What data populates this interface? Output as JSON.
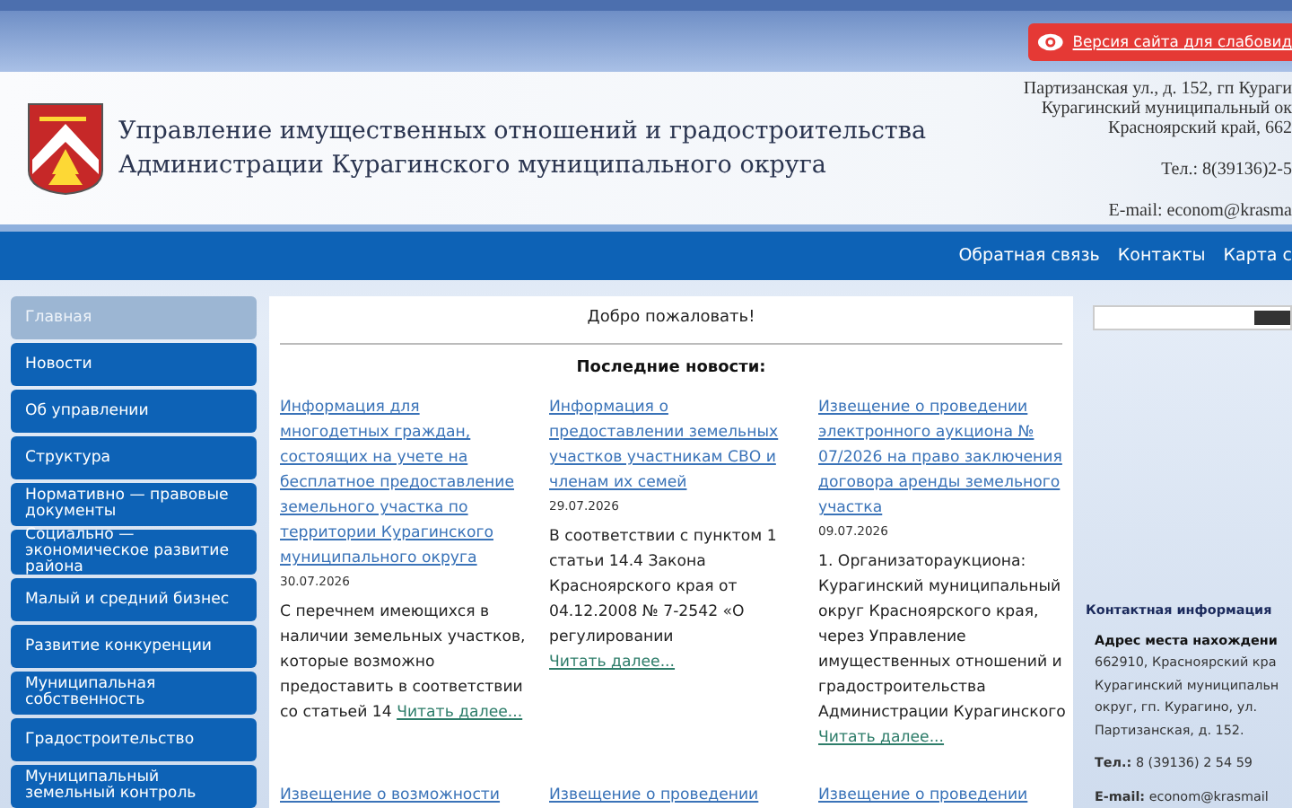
{
  "accessibility_button": {
    "label": "Версия сайта для слабовид"
  },
  "header": {
    "title_lines": [
      "Управление имущественных отношений и градостроительства",
      "Администрации Курагинского муниципального округа"
    ],
    "address_lines": [
      "Партизанская ул., д. 152, гп Кураги",
      "Курагинский муниципальный ок",
      "Красноярский край, 662"
    ],
    "phone": "Тел.: 8(39136)2-5",
    "email": "E-mail: econom@krasma"
  },
  "nav_links": [
    "Обратная связь",
    "Контакты",
    "Карта с"
  ],
  "sidebar": {
    "items": [
      {
        "label": "Главная",
        "selected": true
      },
      {
        "label": "Новости",
        "selected": false
      },
      {
        "label": "Об управлении",
        "selected": false
      },
      {
        "label": "Структура",
        "selected": false
      },
      {
        "label": "Нормативно — правовые документы",
        "selected": false
      },
      {
        "label": "Социально — экономическое развитие района",
        "selected": false
      },
      {
        "label": "Малый и средний бизнес",
        "selected": false
      },
      {
        "label": "Развитие конкуренции",
        "selected": false
      },
      {
        "label": "Муниципальная собственность",
        "selected": false
      },
      {
        "label": "Градостроительство",
        "selected": false
      },
      {
        "label": "Муниципальный земельный контроль",
        "selected": false
      }
    ]
  },
  "welcome": "Добро пожаловать!",
  "news_heading": "Последние новости:",
  "news": [
    {
      "title": "Информация для многодетных граждан, состоящих на учете на бесплатное предоставление земельного участка по территории Курагинского муниципального округа",
      "date": "30.07.2026",
      "excerpt": "С перечнем имеющихся в наличии земельных участков, которые возможно предоставить в соответствии со статьей 14",
      "more": "Читать далее..."
    },
    {
      "title": "Информация о предоставлении земельных участков участникам СВО и членам их семей",
      "date": "29.07.2026",
      "excerpt": "В соответствии с пунктом 1 статьи 14.4  Закона Красноярского края от 04.12.2008  № 7-2542 «О регулировании",
      "more": "Читать далее..."
    },
    {
      "title": "Извещение о проведении электронного аукциона № 07/2026 на право заключения договора аренды земельного участка",
      "date": "09.07.2026",
      "excerpt": "1. Организатораукциона: Курагинский муниципальный округ Красноярского края, через Управление имущественных отношений и градостроительства Администрации Курагинского",
      "more": "Читать далее..."
    }
  ],
  "more_news": [
    "Извещение о возможности",
    "Извещение о проведении",
    "Извещение о проведении"
  ],
  "contact": {
    "heading": "Контактная информация",
    "address_label": "Адрес места нахождени",
    "address_lines": [
      "662910, Красноярский кра",
      "Курагинский муниципальн",
      "округ, гп. Курагино, ул.",
      "Партизанская, д. 152."
    ],
    "phone_label": "Тел.:",
    "phone": "8 (39136) 2 54 59",
    "email_label": "E-mail:",
    "email": "econom@krasmail"
  }
}
